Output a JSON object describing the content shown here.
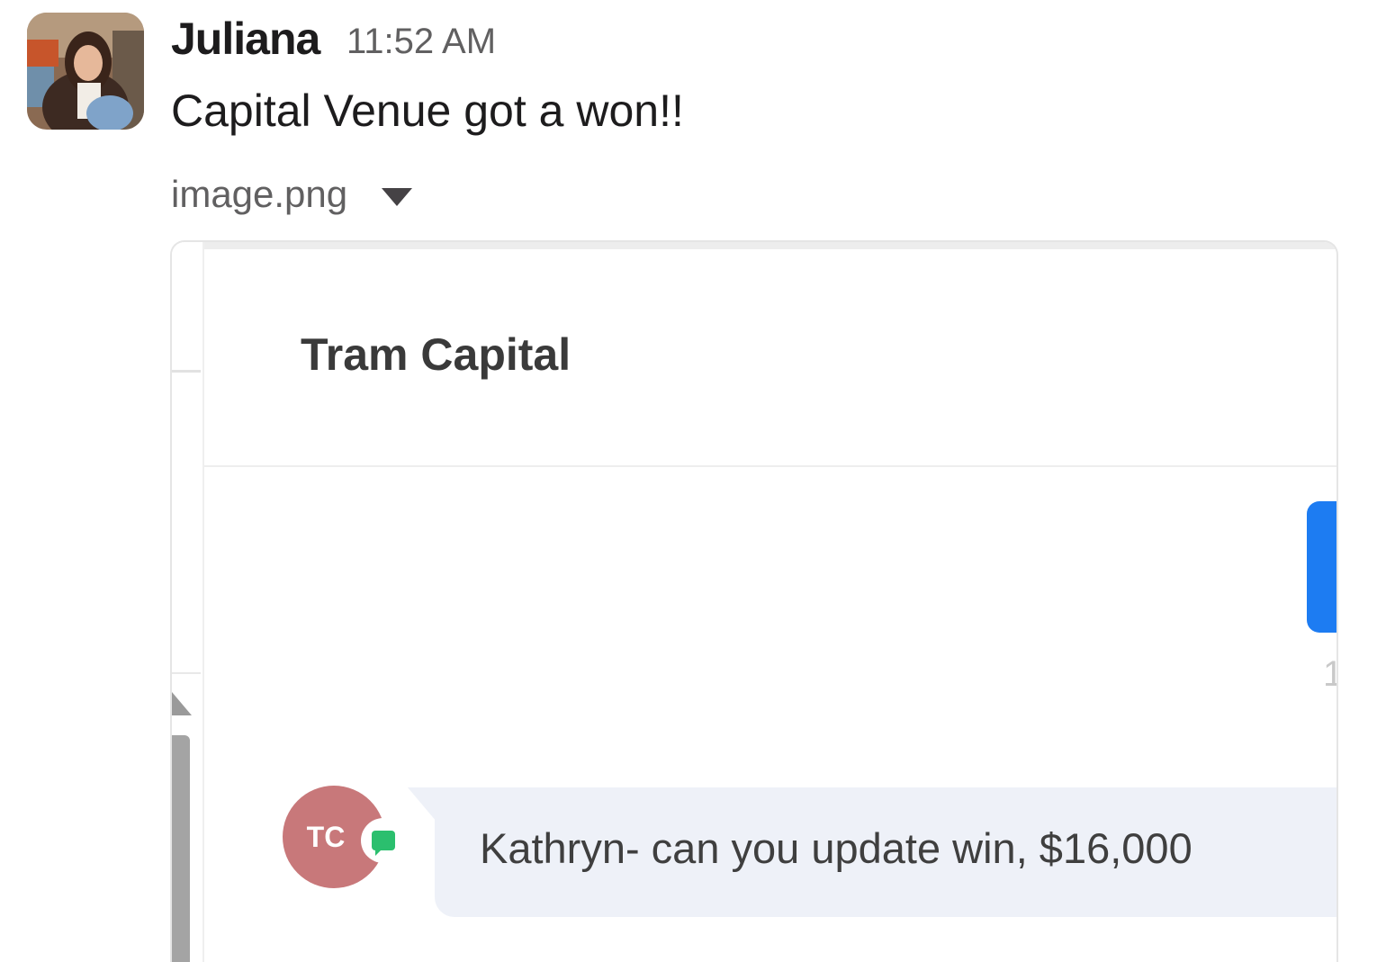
{
  "message": {
    "sender": "Juliana",
    "timestamp": "11:52 AM",
    "text": "Capital Venue got a won!!"
  },
  "attachment": {
    "file_name": "image.png",
    "screenshot": {
      "conversation_title": "Tram Capital",
      "edge_digit": "1",
      "contact_initials": "TC",
      "message_text": "Kathryn- can you update win, $16,000",
      "colors": {
        "accent_blue": "#1d7cf2",
        "contact_avatar": "#c8787a",
        "channel_badge": "#2bbf6e",
        "bubble_bg": "#eef1f8"
      }
    }
  }
}
